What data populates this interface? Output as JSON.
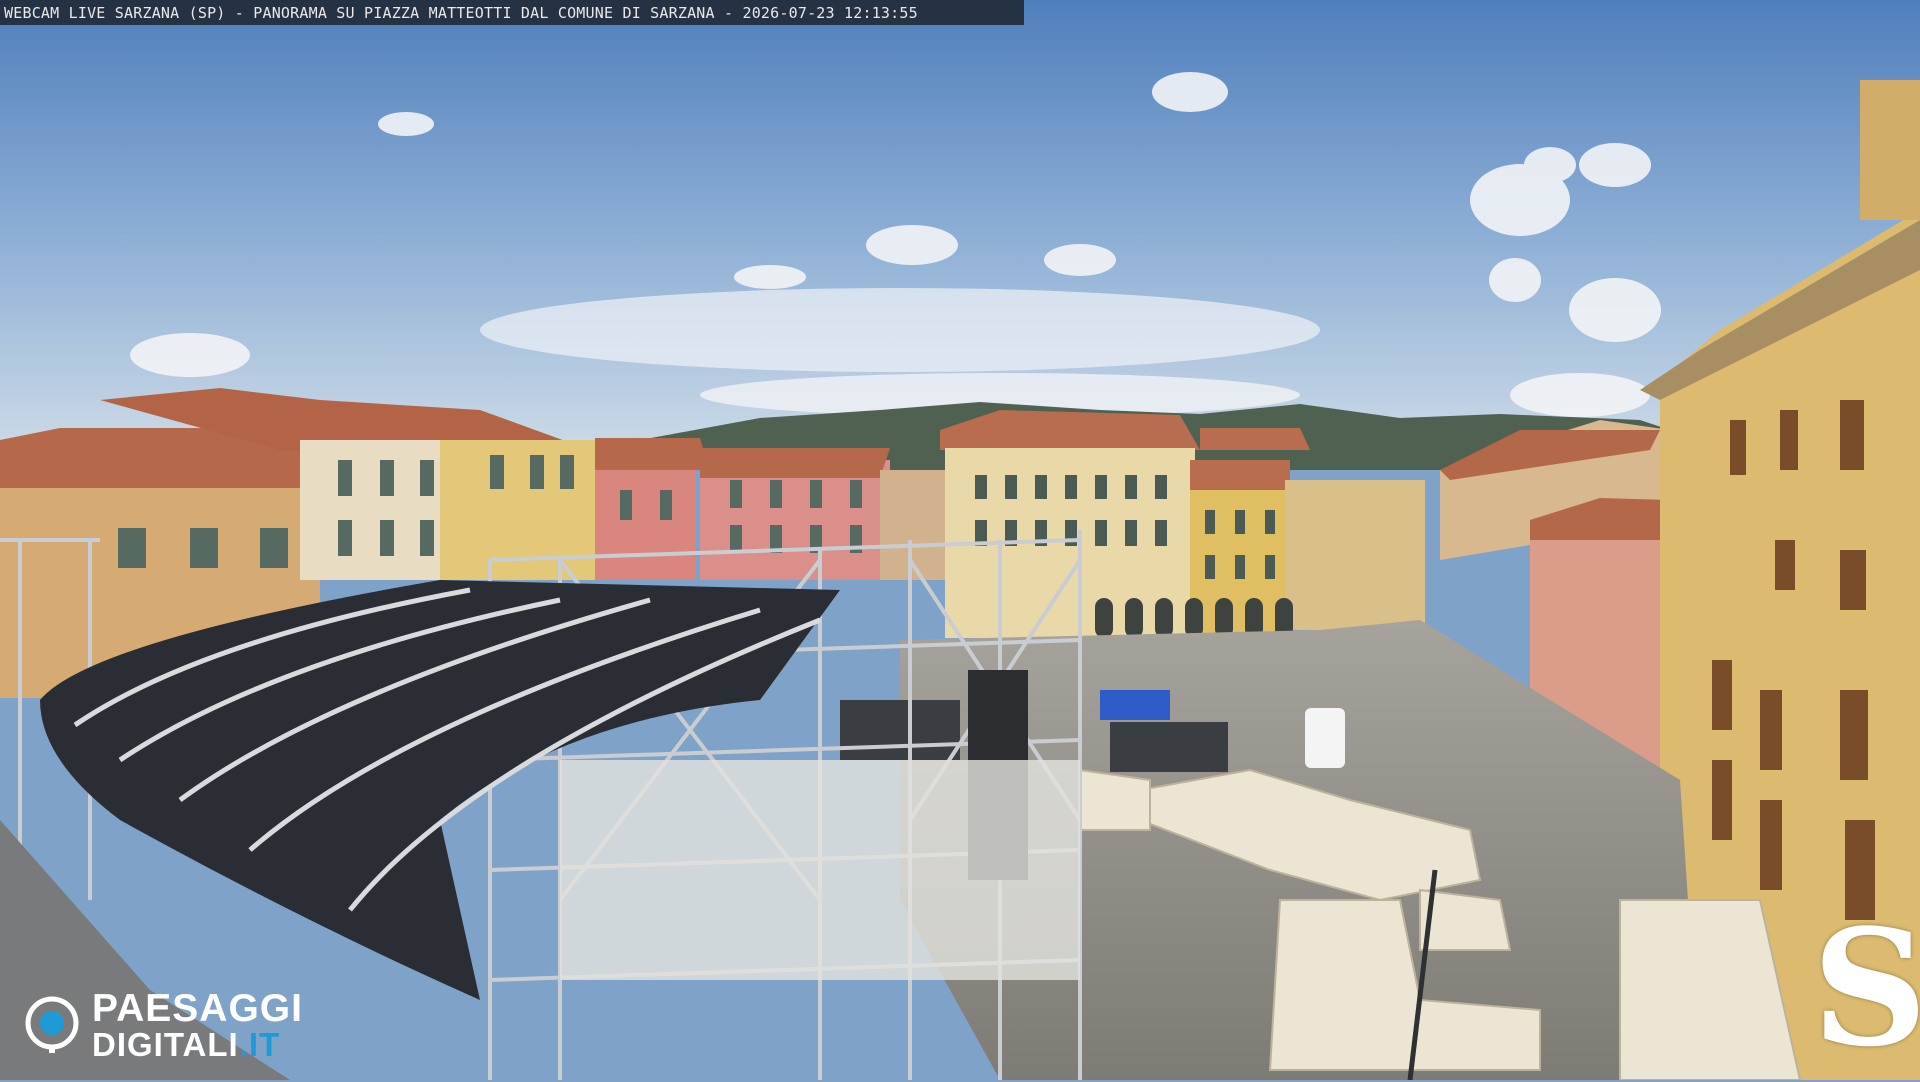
{
  "overlay": {
    "caption": "WEBCAM LIVE SARZANA (SP) - PANORAMA SU PIAZZA MATTEOTTI DAL COMUNE DI SARZANA - 2026-07-23  12:13:55"
  },
  "logo": {
    "line1": "PAESAGGI",
    "line2_main": "DIGITALI",
    "line2_suffix": ".IT",
    "accent_color": "#1e9bd7",
    "icon": "camera-lens-icon"
  },
  "brand_mark": {
    "glyph": "S"
  },
  "colors": {
    "sky": "#6f98c7",
    "roof_terracotta": "#b5694a",
    "facade_yellow": "#d9b56f",
    "facade_pink": "#d88a85",
    "stage_cover": "#2a2d33",
    "pavement": "#9a9790"
  }
}
